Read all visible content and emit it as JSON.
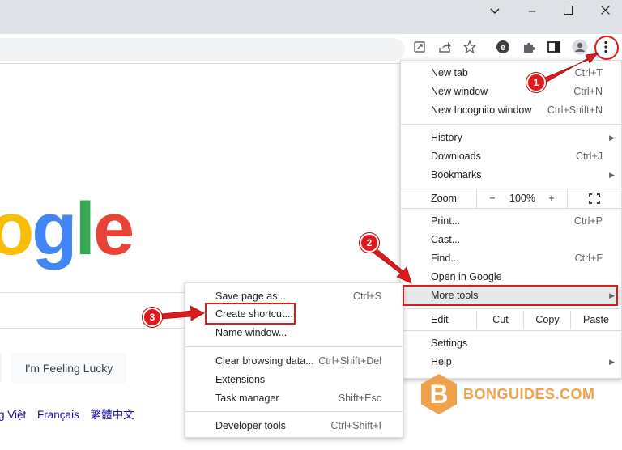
{
  "window": {
    "minimize_icon": "chevron-down",
    "min": "–",
    "max": "☐",
    "close": "✕"
  },
  "menu": {
    "new_tab": "New tab",
    "new_tab_sc": "Ctrl+T",
    "new_window": "New window",
    "new_window_sc": "Ctrl+N",
    "new_incognito": "New Incognito window",
    "new_incognito_sc": "Ctrl+Shift+N",
    "history": "History",
    "downloads": "Downloads",
    "downloads_sc": "Ctrl+J",
    "bookmarks": "Bookmarks",
    "zoom": "Zoom",
    "zoom_minus": "−",
    "zoom_value": "100%",
    "zoom_plus": "+",
    "print": "Print...",
    "print_sc": "Ctrl+P",
    "cast": "Cast...",
    "find": "Find...",
    "find_sc": "Ctrl+F",
    "open_in_google": "Open in Google",
    "more_tools": "More tools",
    "edit": "Edit",
    "cut": "Cut",
    "copy": "Copy",
    "paste": "Paste",
    "settings": "Settings",
    "help": "Help"
  },
  "submenu": {
    "save_page": "Save page as...",
    "save_page_sc": "Ctrl+S",
    "create_shortcut": "Create shortcut...",
    "name_window": "Name window...",
    "clear_browsing": "Clear browsing data...",
    "clear_browsing_sc": "Ctrl+Shift+Del",
    "extensions": "Extensions",
    "task_manager": "Task manager",
    "task_manager_sc": "Shift+Esc",
    "developer_tools": "Developer tools",
    "developer_tools_sc": "Ctrl+Shift+I"
  },
  "page": {
    "logo_letters": [
      "o",
      "g",
      "l",
      "e"
    ],
    "logo_colors": [
      "#fbbc05",
      "#4285f4",
      "#34a853",
      "#ea4335"
    ],
    "lucky_button": "I'm Feeling Lucky",
    "languages": [
      "g Việt",
      "Français",
      "繁體中文"
    ]
  },
  "badges": {
    "step1": "1",
    "step2": "2",
    "step3": "3"
  },
  "watermark": {
    "letter": "B",
    "text": "BONGUIDES.COM"
  },
  "colors": {
    "annotation_red": "#e0191c",
    "watermark_orange": "#f0a24a"
  }
}
